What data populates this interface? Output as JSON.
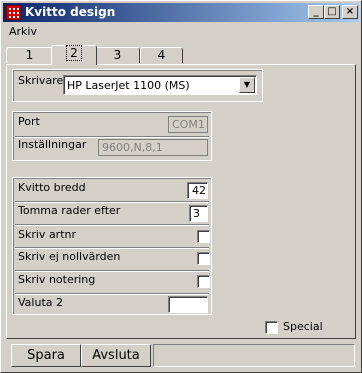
{
  "window": {
    "title": "Kvitto design"
  },
  "titlebar_buttons": {
    "minimize": "_",
    "maximize": "□",
    "close": "×"
  },
  "menu": {
    "items": [
      {
        "label": "Arkiv"
      }
    ]
  },
  "tabs": [
    {
      "label": "1",
      "active": false
    },
    {
      "label": "2",
      "active": true
    },
    {
      "label": "3",
      "active": false
    },
    {
      "label": "4",
      "active": false
    }
  ],
  "printer": {
    "label": "Skrivare",
    "selected": "HP LaserJet 1100 (MS)"
  },
  "connection": {
    "port_label": "Port",
    "port_value": "COM1",
    "settings_label": "Inställningar",
    "settings_value": "9600,N,8,1"
  },
  "receipt": {
    "width_label": "Kvitto bredd",
    "width_value": "42",
    "blank_rows_label": "Tomma rader efter",
    "blank_rows_value": "3",
    "print_artnr_label": "Skriv artnr",
    "print_artnr_checked": false,
    "skip_zero_label": "Skriv ej nollvärden",
    "skip_zero_checked": false,
    "print_note_label": "Skriv notering",
    "print_note_checked": false,
    "currency2_label": "Valuta 2",
    "currency2_value": ""
  },
  "special": {
    "label": "Special",
    "checked": false
  },
  "footer": {
    "save_label": "Spara",
    "exit_label": "Avsluta"
  }
}
